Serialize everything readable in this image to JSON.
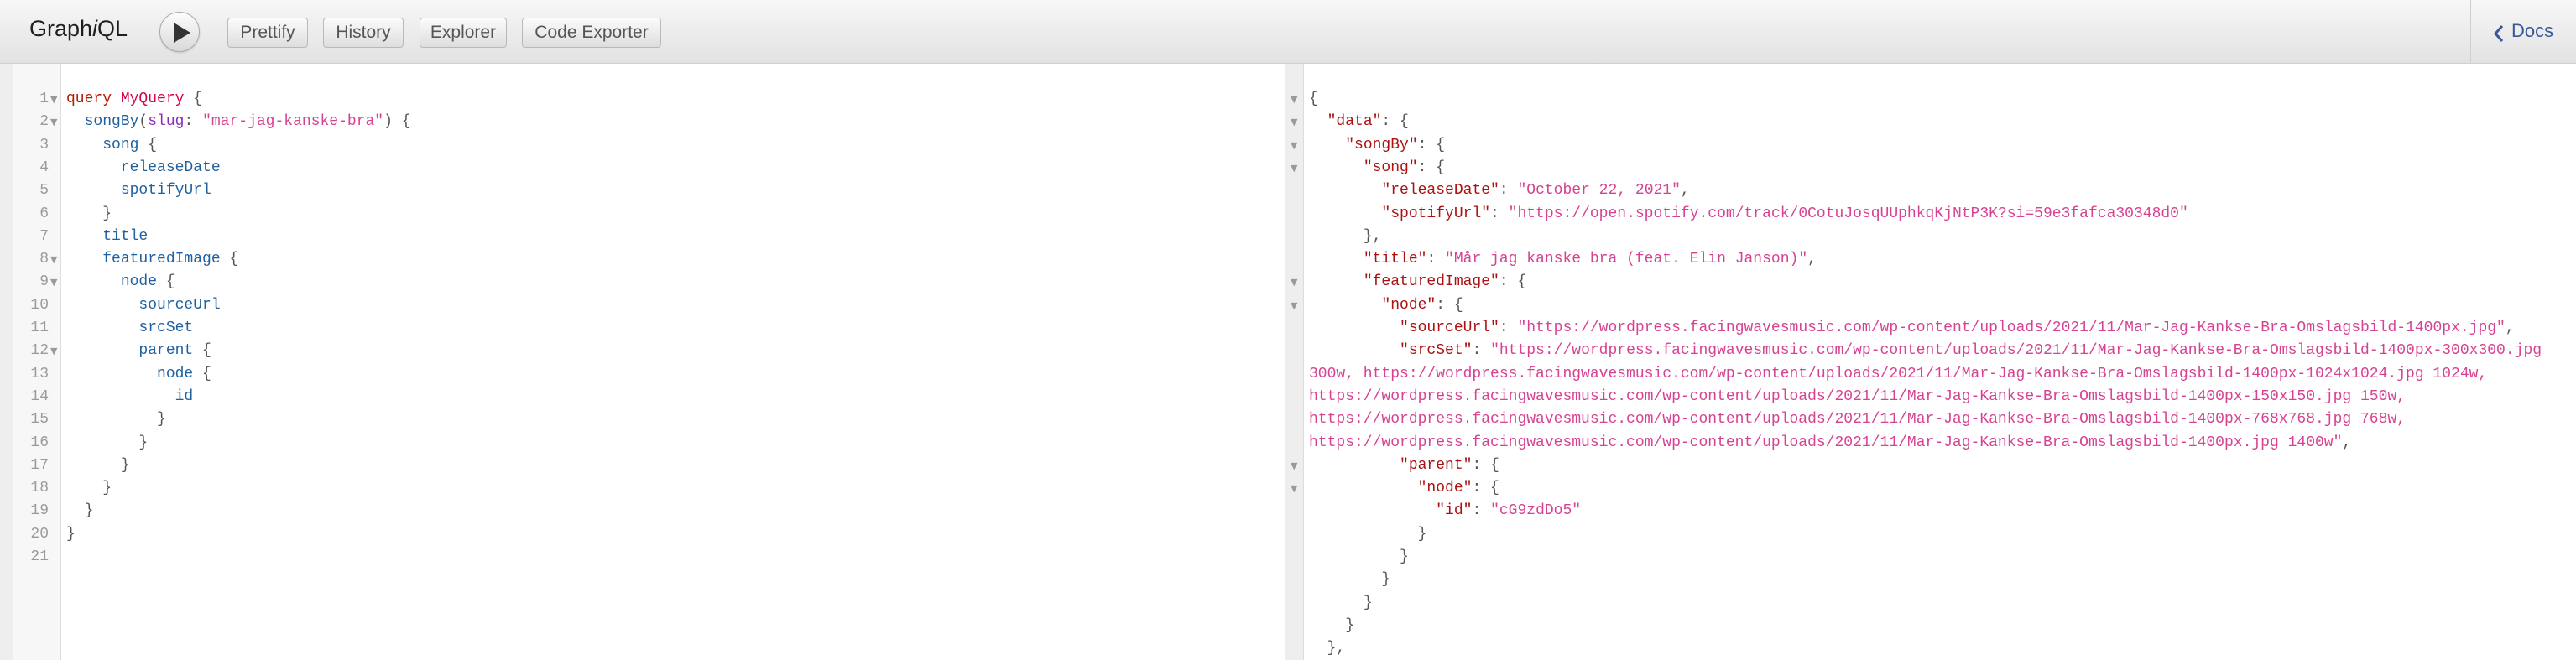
{
  "toolbar": {
    "logo_pre": "Graph",
    "logo_i": "i",
    "logo_post": "QL",
    "buttons": [
      "Prettify",
      "History",
      "Explorer",
      "Code Exporter"
    ],
    "docs_label": "Docs"
  },
  "icons": {
    "execute": "play-icon",
    "docs": "chevron-left-icon",
    "fold": "triangle-down-icon"
  },
  "colors": {
    "keyword": "#b11a04",
    "def": "#d2054e",
    "field": "#1f61a0",
    "argument": "#8b2bb9",
    "string": "#d64292",
    "link": "#3b5998"
  },
  "query": {
    "line_numbers": [
      "1",
      "2",
      "3",
      "4",
      "5",
      "6",
      "7",
      "8",
      "9",
      "10",
      "11",
      "12",
      "13",
      "14",
      "15",
      "16",
      "17",
      "18",
      "19",
      "20",
      "21"
    ],
    "l1": {
      "kw": "query",
      "name": "MyQuery",
      "brace": " {"
    },
    "l2": {
      "field": "songBy",
      "open": "(",
      "arg": "slug",
      "colon": ": ",
      "value": "\"mar-jag-kanske-bra\"",
      "close": ") {"
    },
    "l3": {
      "field": "song",
      "brace": " {"
    },
    "l4": {
      "field": "releaseDate"
    },
    "l5": {
      "field": "spotifyUrl"
    },
    "l6": "}",
    "l7": {
      "field": "title"
    },
    "l8": {
      "field": "featuredImage",
      "brace": " {"
    },
    "l9": {
      "field": "node",
      "brace": " {"
    },
    "l10": {
      "field": "sourceUrl"
    },
    "l11": {
      "field": "srcSet"
    },
    "l12": {
      "field": "parent",
      "brace": " {"
    },
    "l13": {
      "field": "node",
      "brace": " {"
    },
    "l14": {
      "field": "id"
    },
    "l15": "}",
    "l16": "}",
    "l17": "}",
    "l18": "}",
    "l19": "}",
    "l20": "}"
  },
  "result": {
    "r1": "{",
    "r2": {
      "key": "\"data\"",
      "rest": ": {"
    },
    "r3": {
      "key": "\"songBy\"",
      "rest": ": {"
    },
    "r4": {
      "key": "\"song\"",
      "rest": ": {"
    },
    "r5": {
      "key": "\"releaseDate\"",
      "colon": ": ",
      "value": "\"October 22, 2021\"",
      "end": ","
    },
    "r6": {
      "key": "\"spotifyUrl\"",
      "colon": ": ",
      "value": "\"https://open.spotify.com/track/0CotuJosqUUphkqKjNtP3K?si=59e3fafca30348d0\""
    },
    "r7": "},",
    "r8": {
      "key": "\"title\"",
      "colon": ": ",
      "value": "\"Mår jag kanske bra (feat. Elin Janson)\"",
      "end": ","
    },
    "r9": {
      "key": "\"featuredImage\"",
      "rest": ": {"
    },
    "r10": {
      "key": "\"node\"",
      "rest": ": {"
    },
    "r11": {
      "key": "\"sourceUrl\"",
      "colon": ": ",
      "value": "\"https://wordpress.facingwavesmusic.com/wp-content/uploads/2021/11/Mar-Jag-Kankse-Bra-Omslagsbild-1400px.jpg\"",
      "end": ","
    },
    "r12": {
      "key": "\"srcSet\"",
      "colon": ": ",
      "value": "\"https://wordpress.facingwavesmusic.com/wp-content/uploads/2021/11/Mar-Jag-Kankse-Bra-Omslagsbild-1400px-300x300.jpg"
    },
    "r13": "300w, https://wordpress.facingwavesmusic.com/wp-content/uploads/2021/11/Mar-Jag-Kankse-Bra-Omslagsbild-1400px-1024x1024.jpg 1024w,",
    "r14": "https://wordpress.facingwavesmusic.com/wp-content/uploads/2021/11/Mar-Jag-Kankse-Bra-Omslagsbild-1400px-150x150.jpg 150w,",
    "r15": "https://wordpress.facingwavesmusic.com/wp-content/uploads/2021/11/Mar-Jag-Kankse-Bra-Omslagsbild-1400px-768x768.jpg 768w,",
    "r16": {
      "value": "https://wordpress.facingwavesmusic.com/wp-content/uploads/2021/11/Mar-Jag-Kankse-Bra-Omslagsbild-1400px.jpg 1400w\"",
      "end": ","
    },
    "r17": {
      "key": "\"parent\"",
      "rest": ": {"
    },
    "r18": {
      "key": "\"node\"",
      "rest": ": {"
    },
    "r19": {
      "key": "\"id\"",
      "colon": ": ",
      "value": "\"cG9zdDo5\""
    },
    "r20": "}",
    "r21": "}",
    "r22": "}",
    "r23": "}",
    "r24": "}",
    "r25": "},"
  }
}
